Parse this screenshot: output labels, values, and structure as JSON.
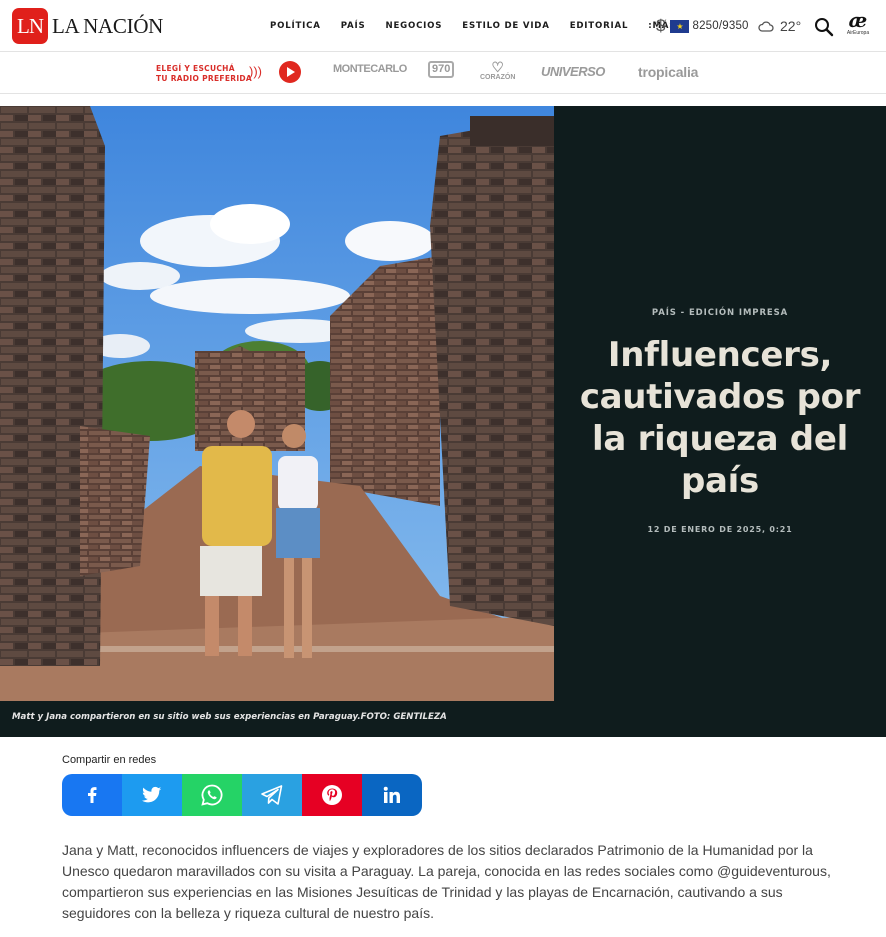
{
  "header": {
    "logo_mark": "LN",
    "logo_text": "LA NACIÓN",
    "nav": [
      "POLÍTICA",
      "PAÍS",
      "NEGOCIOS",
      "ESTILO DE VIDA",
      "EDITORIAL",
      ":MÁS"
    ],
    "currency_symbol": "$",
    "exchange_rate": "8250/9350",
    "temperature": "22°",
    "partner_logo": "æ",
    "partner_logo_sub": "AirEuropa"
  },
  "radio_bar": {
    "promo_line1": "ELEGÍ Y ESCUCHÁ",
    "promo_line2": "TU RADIO PREFERIDA",
    "stations": [
      "MONTECARLO",
      "970",
      "CORAZÓN",
      "UNIVERSO",
      "tropicalia"
    ]
  },
  "article": {
    "kicker": "PAÍS - EDICIÓN IMPRESA",
    "headline_lines": [
      "Influencers,",
      "cautivados por",
      "la riqueza del",
      "país"
    ],
    "date": "12 DE ENERO DE 2025, 0:21",
    "photo_caption": "Matt y Jana compartieron en su sitio web sus experiencias en Paraguay.FOTO: GENTILEZA",
    "share_label": "Compartir en redes",
    "lead_paragraph": "Jana y Matt, reconocidos influencers de viajes y exploradores de los sitios declarados Patrimonio de la Humanidad por la Unesco quedaron maravillados con su visita a Paraguay. La pareja, conocida en las redes sociales como @guideventurous, compartieron sus experiencias en las Misiones Jesuíticas de Trinidad y las playas de Encarnación, cautivando a sus seguidores con la belleza y riqueza cultural de nuestro país."
  },
  "share_buttons": [
    "facebook-icon",
    "twitter-icon",
    "whatsapp-icon",
    "telegram-icon",
    "pinterest-icon",
    "linkedin-icon"
  ],
  "colors": {
    "brand_red": "#e0201b",
    "hero_panel": "#0f1c1d",
    "headline_text": "#e7e3d8",
    "facebook": "#1877f2",
    "twitter": "#1d9bf0",
    "whatsapp": "#25d366",
    "telegram": "#2aa1e1",
    "pinterest": "#e60023",
    "linkedin": "#0a66c2"
  }
}
